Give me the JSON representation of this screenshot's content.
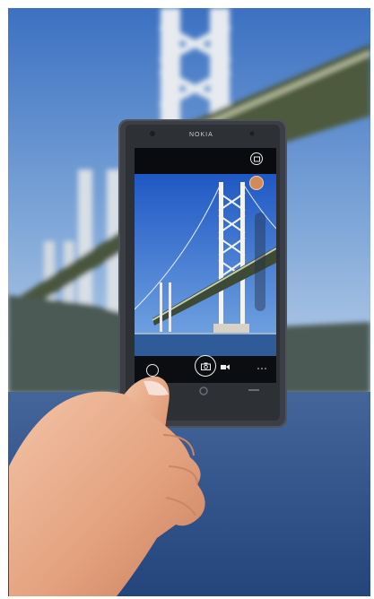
{
  "scene": {
    "type": "photo",
    "subject": "hand-holding-smartphone-camera-app",
    "background_subject": "suspension-bridge",
    "colors": {
      "sky_top": "#3f76c6",
      "sky_bottom": "#a9c6e6",
      "water": "#2a4d86",
      "phone_body": "#5b5e64",
      "tower": "#dfe4ea",
      "skin": "#e9b08f"
    }
  },
  "phone": {
    "brand": "NOKIA"
  },
  "camera_app": {
    "icons": [
      "lens-switch-icon",
      "shutter-icon",
      "video-icon",
      "more-icon",
      "gallery-icon",
      "settings-icon"
    ]
  }
}
